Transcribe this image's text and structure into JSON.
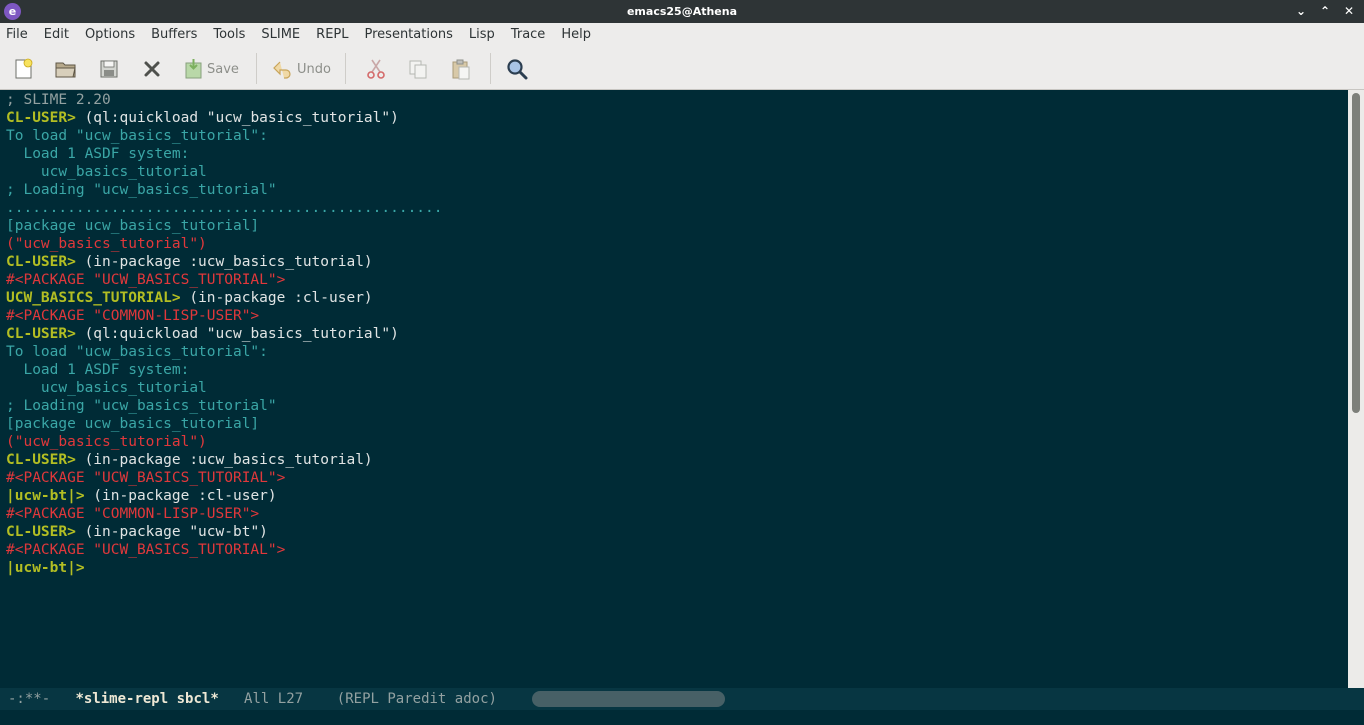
{
  "window": {
    "title": "emacs25@Athena",
    "app_icon_glyph": "e"
  },
  "menubar": {
    "items": [
      "File",
      "Edit",
      "Options",
      "Buffers",
      "Tools",
      "SLIME",
      "REPL",
      "Presentations",
      "Lisp",
      "Trace",
      "Help"
    ]
  },
  "toolbar": {
    "save_label": "Save",
    "undo_label": "Undo",
    "icons": [
      "new-file-icon",
      "open-folder-icon",
      "save-disk-icon",
      "close-icon",
      "save-icon",
      "undo-icon",
      "cut-icon",
      "copy-icon",
      "paste-icon",
      "search-icon"
    ]
  },
  "repl": {
    "lines": [
      {
        "type": "comment",
        "text": "; SLIME 2.20"
      },
      {
        "type": "prompt",
        "prompt": "CL-USER>",
        "input": " (ql:quickload \"ucw_basics_tutorial\")"
      },
      {
        "type": "output",
        "text": "To load \"ucw_basics_tutorial\":"
      },
      {
        "type": "output",
        "text": "  Load 1 ASDF system:"
      },
      {
        "type": "output",
        "text": "    ucw_basics_tutorial"
      },
      {
        "type": "output",
        "text": "; Loading \"ucw_basics_tutorial\""
      },
      {
        "type": "output",
        "text": ".................................................."
      },
      {
        "type": "output",
        "text": "[package ucw_basics_tutorial]"
      },
      {
        "type": "result",
        "text": "(\"ucw_basics_tutorial\")"
      },
      {
        "type": "prompt",
        "prompt": "CL-USER>",
        "input": " (in-package :ucw_basics_tutorial)"
      },
      {
        "type": "result",
        "text": "#<PACKAGE \"UCW_BASICS_TUTORIAL\">"
      },
      {
        "type": "prompt",
        "prompt": "UCW_BASICS_TUTORIAL>",
        "input": " (in-package :cl-user)"
      },
      {
        "type": "result",
        "text": "#<PACKAGE \"COMMON-LISP-USER\">"
      },
      {
        "type": "prompt",
        "prompt": "CL-USER>",
        "input": " (ql:quickload \"ucw_basics_tutorial\")"
      },
      {
        "type": "output",
        "text": "To load \"ucw_basics_tutorial\":"
      },
      {
        "type": "output",
        "text": "  Load 1 ASDF system:"
      },
      {
        "type": "output",
        "text": "    ucw_basics_tutorial"
      },
      {
        "type": "output",
        "text": "; Loading \"ucw_basics_tutorial\""
      },
      {
        "type": "output",
        "text": "[package ucw_basics_tutorial]"
      },
      {
        "type": "result",
        "text": "(\"ucw_basics_tutorial\")"
      },
      {
        "type": "prompt",
        "prompt": "CL-USER>",
        "input": " (in-package :ucw_basics_tutorial)"
      },
      {
        "type": "result",
        "text": "#<PACKAGE \"UCW_BASICS_TUTORIAL\">"
      },
      {
        "type": "prompt",
        "prompt": "|ucw-bt|>",
        "input": " (in-package :cl-user)"
      },
      {
        "type": "result",
        "text": "#<PACKAGE \"COMMON-LISP-USER\">"
      },
      {
        "type": "prompt",
        "prompt": "CL-USER>",
        "input": " (in-package \"ucw-bt\")"
      },
      {
        "type": "result",
        "text": "#<PACKAGE \"UCW_BASICS_TUTORIAL\">"
      },
      {
        "type": "prompt",
        "prompt": "|ucw-bt|>",
        "input": ""
      }
    ]
  },
  "modeline": {
    "status": "-:**-",
    "buffer_name": "*slime-repl sbcl*",
    "position": "All L27",
    "modes": "(REPL Paredit adoc)"
  },
  "colors": {
    "background": "#002b36",
    "prompt": "#b3be23",
    "output": "#3aa6a6",
    "result": "#e0383b",
    "comment": "#93a1a1"
  }
}
